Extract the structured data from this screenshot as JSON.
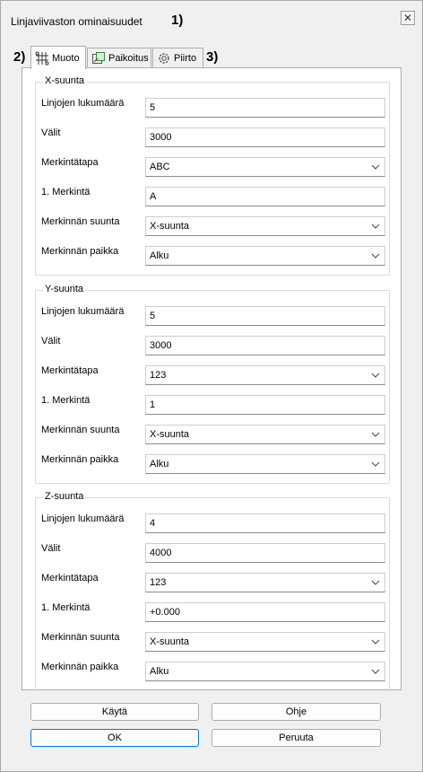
{
  "window": {
    "title": "Linjaviivaston ominaisuudet",
    "close_glyph": "✕"
  },
  "annotations": [
    "1)",
    "2)",
    "3)"
  ],
  "tabs": [
    {
      "label": "Muoto",
      "icon": "grid-lines-icon",
      "active": true
    },
    {
      "label": "Paikoitus",
      "icon": "placement-icon",
      "active": false
    },
    {
      "label": "Piirto",
      "icon": "gear-icon",
      "active": false
    }
  ],
  "labels": {
    "count": "Linjojen lukumäärä",
    "spacing": "Välit",
    "marking_type": "Merkintätapa",
    "first_mark": "1. Merkintä",
    "mark_direction": "Merkinnän suunta",
    "mark_position": "Merkinnän paikka"
  },
  "groups": [
    {
      "title": "X-suunta",
      "count": "5",
      "spacing": "3000",
      "marking_type": "ABC",
      "first_mark": "A",
      "mark_direction": "X-suunta",
      "mark_position": "Alku"
    },
    {
      "title": "Y-suunta",
      "count": "5",
      "spacing": "3000",
      "marking_type": "123",
      "first_mark": "1",
      "mark_direction": "X-suunta",
      "mark_position": "Alku"
    },
    {
      "title": "Z-suunta",
      "count": "4",
      "spacing": "4000",
      "marking_type": "123",
      "first_mark": "+0.000",
      "mark_direction": "X-suunta",
      "mark_position": "Alku"
    }
  ],
  "buttons": {
    "apply": "Käytä",
    "help": "Ohje",
    "ok": "OK",
    "cancel": "Peruuta"
  },
  "colors": {
    "default_button_border": "#0078d7",
    "window_background": "#f0f0f0"
  }
}
